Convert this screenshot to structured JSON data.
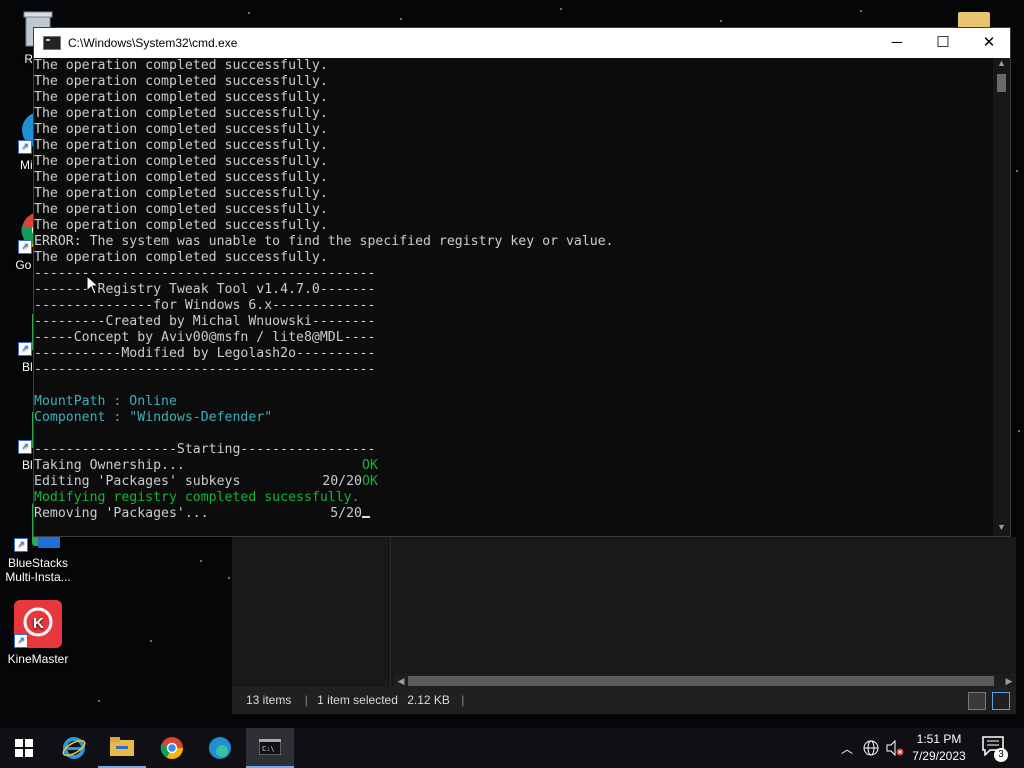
{
  "desktop": {
    "icons": [
      {
        "label": "Recy",
        "icon": "recycle-bin-icon"
      },
      {
        "label": "Mic E",
        "icon": "edge-icon"
      },
      {
        "label": "Go Chi",
        "icon": "chrome-icon"
      },
      {
        "label": "BlueS",
        "icon": "bluestacks-icon"
      },
      {
        "label": "BlueS",
        "icon": "bluestacks-icon"
      },
      {
        "label": "BlueStacks Multi-Insta...",
        "icon": "bluestacks-multi-icon"
      },
      {
        "label": "KineMaster",
        "icon": "kinemaster-icon"
      }
    ]
  },
  "cmd": {
    "title": "C:\\Windows\\System32\\cmd.exe",
    "lines": [
      {
        "text": "The operation completed successfully.",
        "color": "default"
      },
      {
        "text": "The operation completed successfully.",
        "color": "default"
      },
      {
        "text": "The operation completed successfully.",
        "color": "default"
      },
      {
        "text": "The operation completed successfully.",
        "color": "default"
      },
      {
        "text": "The operation completed successfully.",
        "color": "default"
      },
      {
        "text": "The operation completed successfully.",
        "color": "default"
      },
      {
        "text": "The operation completed successfully.",
        "color": "default"
      },
      {
        "text": "The operation completed successfully.",
        "color": "default"
      },
      {
        "text": "The operation completed successfully.",
        "color": "default"
      },
      {
        "text": "The operation completed successfully.",
        "color": "default"
      },
      {
        "text": "The operation completed successfully.",
        "color": "default"
      },
      {
        "text": "ERROR: The system was unable to find the specified registry key or value.",
        "color": "default"
      },
      {
        "text": "The operation completed successfully.",
        "color": "default"
      },
      {
        "text": "-------------------------------------------",
        "color": "default"
      },
      {
        "text": "--------Registry Tweak Tool v1.4.7.0-------",
        "color": "default"
      },
      {
        "text": "---------------for Windows 6.x-------------",
        "color": "default"
      },
      {
        "text": "---------Created by Michal Wnuowski--------",
        "color": "default"
      },
      {
        "text": "-----Concept by Aviv00@msfn / lite8@MDL----",
        "color": "default"
      },
      {
        "text": "-----------Modified by Legolash2o----------",
        "color": "default"
      },
      {
        "text": "-------------------------------------------",
        "color": "default"
      },
      {
        "text": "",
        "color": "default"
      },
      {
        "text": "MountPath : Online",
        "color": "cyan"
      },
      {
        "text": "Component : \"Windows-Defender\"",
        "color": "cyan"
      },
      {
        "text": "",
        "color": "default"
      },
      {
        "text": "------------------Starting-----------------",
        "color": "default"
      }
    ],
    "status_lines": [
      {
        "label": "Taking Ownership...",
        "value": "",
        "ok": "OK"
      },
      {
        "label": "Editing 'Packages' subkeys",
        "value": "20/20",
        "ok": "OK"
      }
    ],
    "success_line": "Modifying registry completed sucessfully.",
    "progress_line": {
      "label": "Removing 'Packages'...",
      "value": "5/20"
    }
  },
  "explorer": {
    "items_count": "13 items",
    "selection": "1 item selected",
    "size": "2.12 KB",
    "separator": "|"
  },
  "taskbar": {
    "apps": [
      "start-icon",
      "internet-explorer-icon",
      "file-explorer-icon",
      "chrome-icon",
      "edge-icon",
      "cmd-icon"
    ],
    "time": "1:51 PM",
    "date": "7/29/2023",
    "notifications": "3"
  },
  "colors": {
    "console_bg": "#0c0c0c",
    "console_text": "#cccccc",
    "cyan": "#3ab0b8",
    "green": "#15b436"
  }
}
